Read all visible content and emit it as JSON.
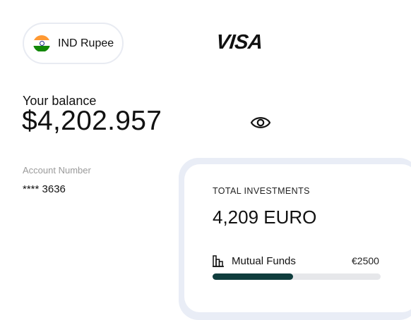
{
  "currency": {
    "label": "IND Rupee",
    "flag_icon": "india-flag-icon",
    "flag_colors": [
      "#ff9933",
      "#ffffff",
      "#138808"
    ]
  },
  "brand": {
    "logo_text": "VISA"
  },
  "balance": {
    "label": "Your balance",
    "value": "$4,202.957",
    "toggle_icon": "eye-icon"
  },
  "account": {
    "label": "Account Number",
    "value": "**** 3636"
  },
  "investments": {
    "title": "TOTAL INVESTMENTS",
    "total": "4,209 EURO",
    "fund": {
      "icon": "bar-chart-icon",
      "label": "Mutual Funds",
      "amount": "€2500",
      "progress": 0.48,
      "progress_color": "#0f3d3d"
    }
  }
}
